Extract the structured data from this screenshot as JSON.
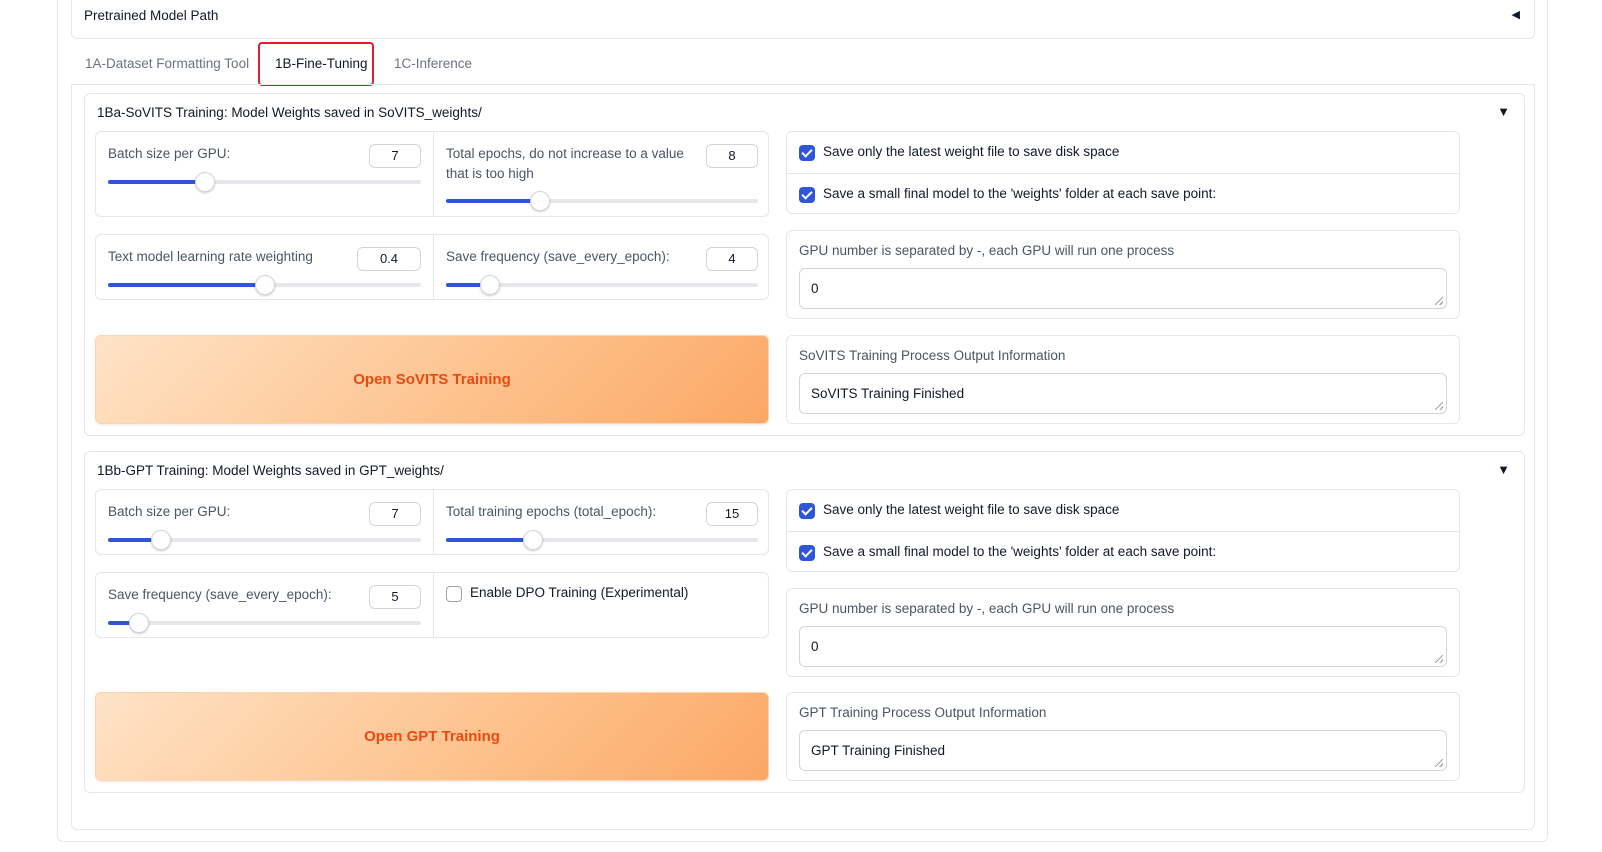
{
  "pretrained": {
    "label": "Pretrained Model Path",
    "arrow": "◀"
  },
  "tabs": [
    {
      "label": "1A-Dataset Formatting Tool"
    },
    {
      "label": "1B-Fine-Tuning"
    },
    {
      "label": "1C-Inference"
    }
  ],
  "sovits": {
    "title": "1Ba-SoVITS Training: Model Weights saved in SoVITS_weights/",
    "arrow": "▼",
    "batch": {
      "label": "Batch size per GPU:",
      "value": "7",
      "fraction": 0.31
    },
    "epochs": {
      "label": "Total epochs, do not increase to a value that is too high",
      "value": "8",
      "fraction": 0.3
    },
    "text_lr": {
      "label": "Text model learning rate weighting",
      "value": "0.4",
      "fraction": 0.5
    },
    "save_freq": {
      "label": "Save frequency (save_every_epoch):",
      "value": "4",
      "fraction": 0.14
    },
    "check_latest": "Save only the latest weight file to save disk space",
    "check_small": "Save a small final model to the 'weights' folder at each save point:",
    "gpu_label": "GPU number is separated by -, each GPU will run one process",
    "gpu_value": "0",
    "button": "Open SoVITS Training",
    "output_label": "SoVITS Training Process Output Information",
    "output_value": "SoVITS Training Finished"
  },
  "gpt": {
    "title": "1Bb-GPT Training: Model Weights saved in GPT_weights/",
    "arrow": "▼",
    "batch": {
      "label": "Batch size per GPU:",
      "value": "7",
      "fraction": 0.17
    },
    "epochs": {
      "label": "Total training epochs (total_epoch):",
      "value": "15",
      "fraction": 0.28
    },
    "save_freq": {
      "label": "Save frequency (save_every_epoch):",
      "value": "5",
      "fraction": 0.1
    },
    "dpo": "Enable DPO Training (Experimental)",
    "check_latest": "Save only the latest weight file to save disk space",
    "check_small": "Save a small final model to the 'weights' folder at each save point:",
    "gpu_label": "GPU number is separated by -, each GPU will run one process",
    "gpu_value": "0",
    "button": "Open GPT Training",
    "output_label": "GPT Training Process Output Information",
    "output_value": "GPT Training Finished"
  },
  "colors": {
    "accent": "#2f56d8",
    "button_text": "#ea4a12",
    "highlight": "#e11d2b"
  }
}
